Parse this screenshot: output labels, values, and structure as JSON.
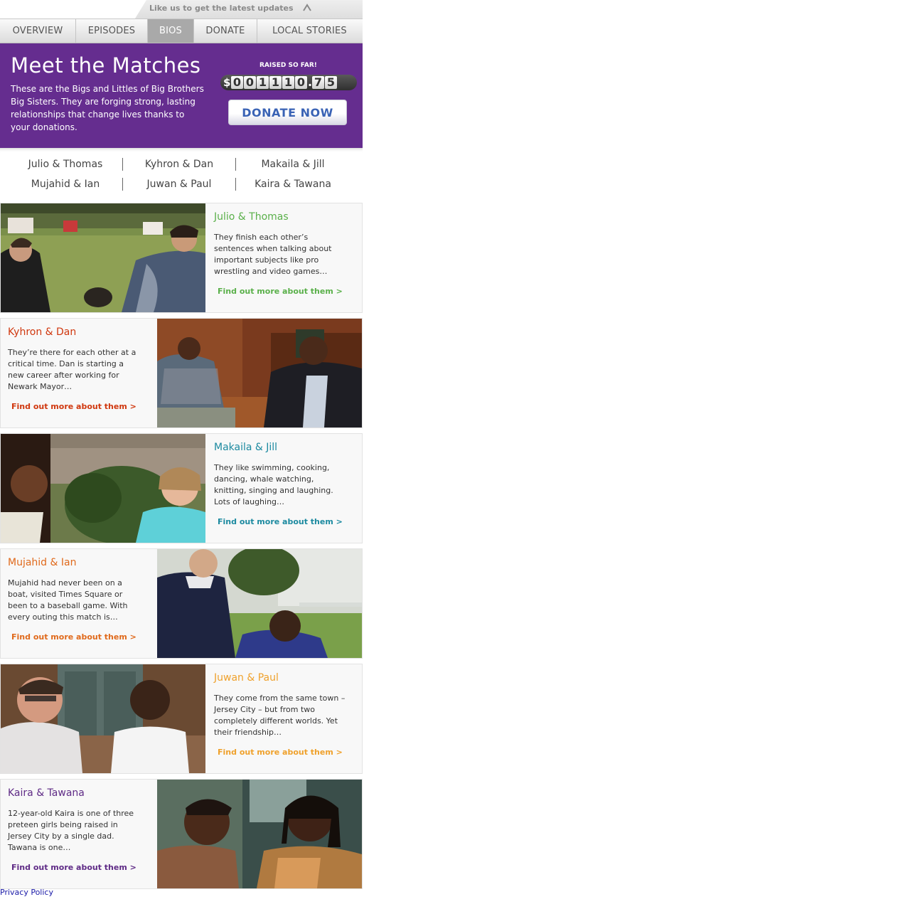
{
  "topbar": {
    "message": "Like us to get the latest updates"
  },
  "nav": {
    "tabs": [
      "OVERVIEW",
      "EPISODES",
      "BIOS",
      "DONATE",
      "LOCAL STORIES"
    ],
    "active": "BIOS"
  },
  "hero": {
    "title": "Meet the Matches",
    "intro": "These are the Bigs and Littles of Big Brothers Big Sisters. They are forging strong, lasting relationships that change lives thanks to your donations.",
    "raised_label": "RAISED SO FAR!",
    "currency": "$",
    "amount_digits": [
      "0",
      "0",
      "1",
      "1",
      "1",
      "0",
      ".",
      "7",
      "5"
    ],
    "amount": "001110.75",
    "donate_button": "DONATE NOW",
    "background": "#652d8f"
  },
  "quick_links": [
    [
      "Julio & Thomas",
      "Kyhron & Dan",
      "Makaila & Jill"
    ],
    [
      "Mujahid & Ian",
      "Juwan & Paul",
      "Kaira & Tawana"
    ]
  ],
  "cards": [
    {
      "title": "Julio & Thomas",
      "color": "#5ab04a",
      "photo_side": "left",
      "description": "They finish each other’s sentences when talking about important subjects like pro wrestling and video games…",
      "link": "Find out more about them >"
    },
    {
      "title": "Kyhron & Dan",
      "color": "#d0380f",
      "photo_side": "right",
      "description": "They’re there for each other at a critical time. Dan is starting a new career after working for Newark Mayor…",
      "link": "Find out more about them >"
    },
    {
      "title": "Makaila & Jill",
      "color": "#1c8aa0",
      "photo_side": "left",
      "description": "They like swimming, cooking, dancing, whale watching, knitting, singing and laughing. Lots of laughing…",
      "link": "Find out more about them >"
    },
    {
      "title": "Mujahid & Ian",
      "color": "#e06a1c",
      "photo_side": "right",
      "description": "Mujahid had never been on a boat, visited Times Square or been to a baseball game. With every outing this match is…",
      "link": "Find out more about them >"
    },
    {
      "title": "Juwan & Paul",
      "color": "#efa12c",
      "photo_side": "left",
      "description": "They come from the same town – Jersey City – but from two completely different worlds. Yet their friendship…",
      "link": "Find out more about them >"
    },
    {
      "title": "Kaira & Tawana",
      "color": "#5f2b86",
      "photo_side": "right",
      "description": "12-year-old Kaira is one of three preteen girls being raised in Jersey City by a single dad. Tawana is one…",
      "link": "Find out more about them >"
    }
  ],
  "footer": {
    "privacy": "Privacy Policy"
  }
}
